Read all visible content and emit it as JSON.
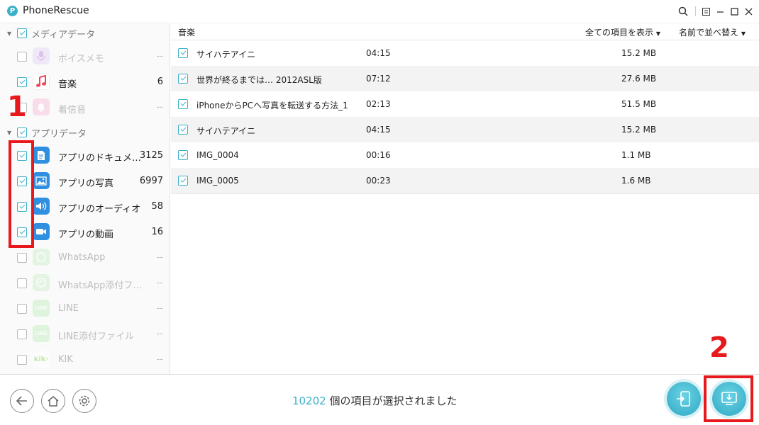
{
  "app": {
    "title": "PhoneRescue",
    "logo_letter": "P"
  },
  "sidebar": {
    "categories": [
      {
        "label": "メディアデータ"
      },
      {
        "label": "アプリデータ"
      }
    ],
    "items": [
      {
        "label": "ボイスメモ",
        "count": "--",
        "checked": false,
        "icon": "voice-memo-icon"
      },
      {
        "label": "音楽",
        "count": "6",
        "checked": true,
        "icon": "music-note-icon"
      },
      {
        "label": "着信音",
        "count": "--",
        "checked": false,
        "icon": "bell-icon"
      },
      {
        "label": "アプリのドキュメ…",
        "count": "3125",
        "checked": true,
        "icon": "document-icon"
      },
      {
        "label": "アプリの写真",
        "count": "6997",
        "checked": true,
        "icon": "photo-icon"
      },
      {
        "label": "アプリのオーディオ",
        "count": "58",
        "checked": true,
        "icon": "speaker-icon"
      },
      {
        "label": "アプリの動画",
        "count": "16",
        "checked": true,
        "icon": "video-camera-icon"
      },
      {
        "label": "WhatsApp",
        "count": "--",
        "checked": false,
        "icon": "whatsapp-icon"
      },
      {
        "label": "WhatsApp添付フ…",
        "count": "--",
        "checked": false,
        "icon": "whatsapp-attachment-icon"
      },
      {
        "label": "LINE",
        "count": "--",
        "checked": false,
        "icon": "line-icon",
        "icon_text": "LINE"
      },
      {
        "label": "LINE添付ファイル",
        "count": "--",
        "checked": false,
        "icon": "line-attachment-icon",
        "icon_text": "LINE"
      },
      {
        "label": "KIK",
        "count": "--",
        "checked": false,
        "icon": "kik-icon",
        "icon_text": "kik·"
      }
    ]
  },
  "list": {
    "header_title": "音楽",
    "filter_label": "全ての項目を表示",
    "sort_label": "名前で並べ替え",
    "rows": [
      {
        "name": "サイハテアイニ",
        "duration": "04:15",
        "size": "15.2 MB"
      },
      {
        "name": "世界が終るまでは… 2012ASL版",
        "duration": "07:12",
        "size": "27.6 MB"
      },
      {
        "name": "iPhoneからPCへ写真を転送する方法_1",
        "duration": "02:13",
        "size": "51.5 MB"
      },
      {
        "name": "サイハテアイニ",
        "duration": "04:15",
        "size": "15.2 MB"
      },
      {
        "name": "IMG_0004",
        "duration": "00:16",
        "size": "1.1 MB"
      },
      {
        "name": "IMG_0005",
        "duration": "00:23",
        "size": "1.6 MB"
      }
    ]
  },
  "footer": {
    "selected_count": "10202",
    "selected_text": " 個の項目が選択されました"
  },
  "annotations": {
    "step1": "1",
    "step2": "2"
  },
  "colors": {
    "accent": "#3bb0c9",
    "annotation": "#e8191c"
  }
}
